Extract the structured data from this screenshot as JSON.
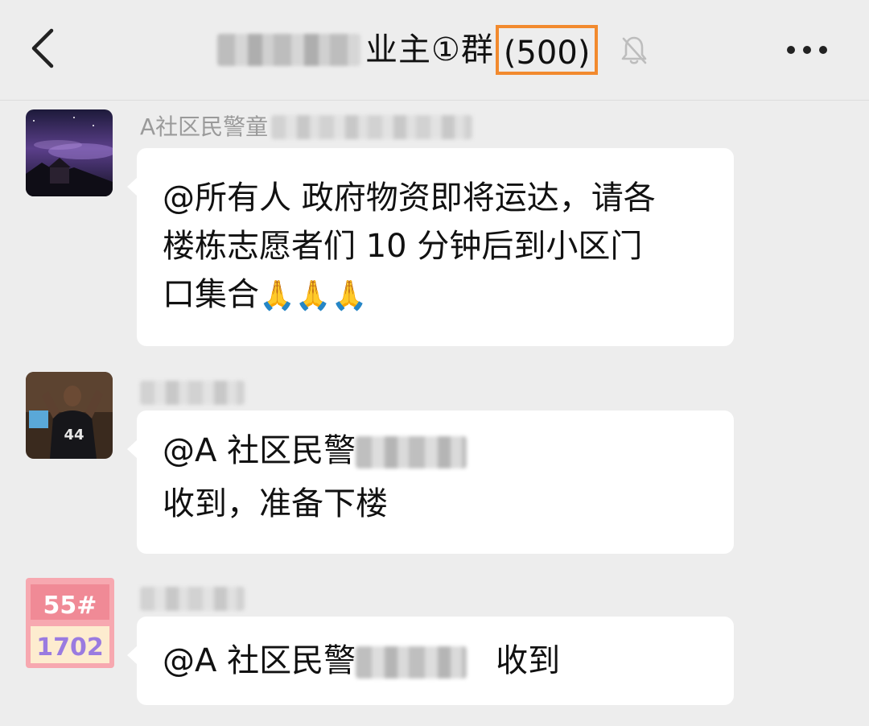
{
  "header": {
    "title_suffix": "业主①群",
    "member_count": "(500)"
  },
  "messages": [
    {
      "sender_visible": "A社区民警童",
      "lines": [
        "@所有人 政府物资即将运达，请各",
        "楼栋志愿者们 10 分钟后到小区门",
        "口集合"
      ],
      "emoji": "🙏🙏🙏"
    },
    {
      "sender_visible": "",
      "mention": "@A 社区民警",
      "line2": "收到，准备下楼"
    },
    {
      "sender_visible": "",
      "mention": "@A 社区民警",
      "after": "收到",
      "avatar_text_top": "55#",
      "avatar_text_bottom": "1702"
    }
  ],
  "colors": {
    "background": "#ededed",
    "bubble": "#ffffff",
    "highlight_border": "#f28a2e",
    "sender_text": "#9a9a9a"
  }
}
